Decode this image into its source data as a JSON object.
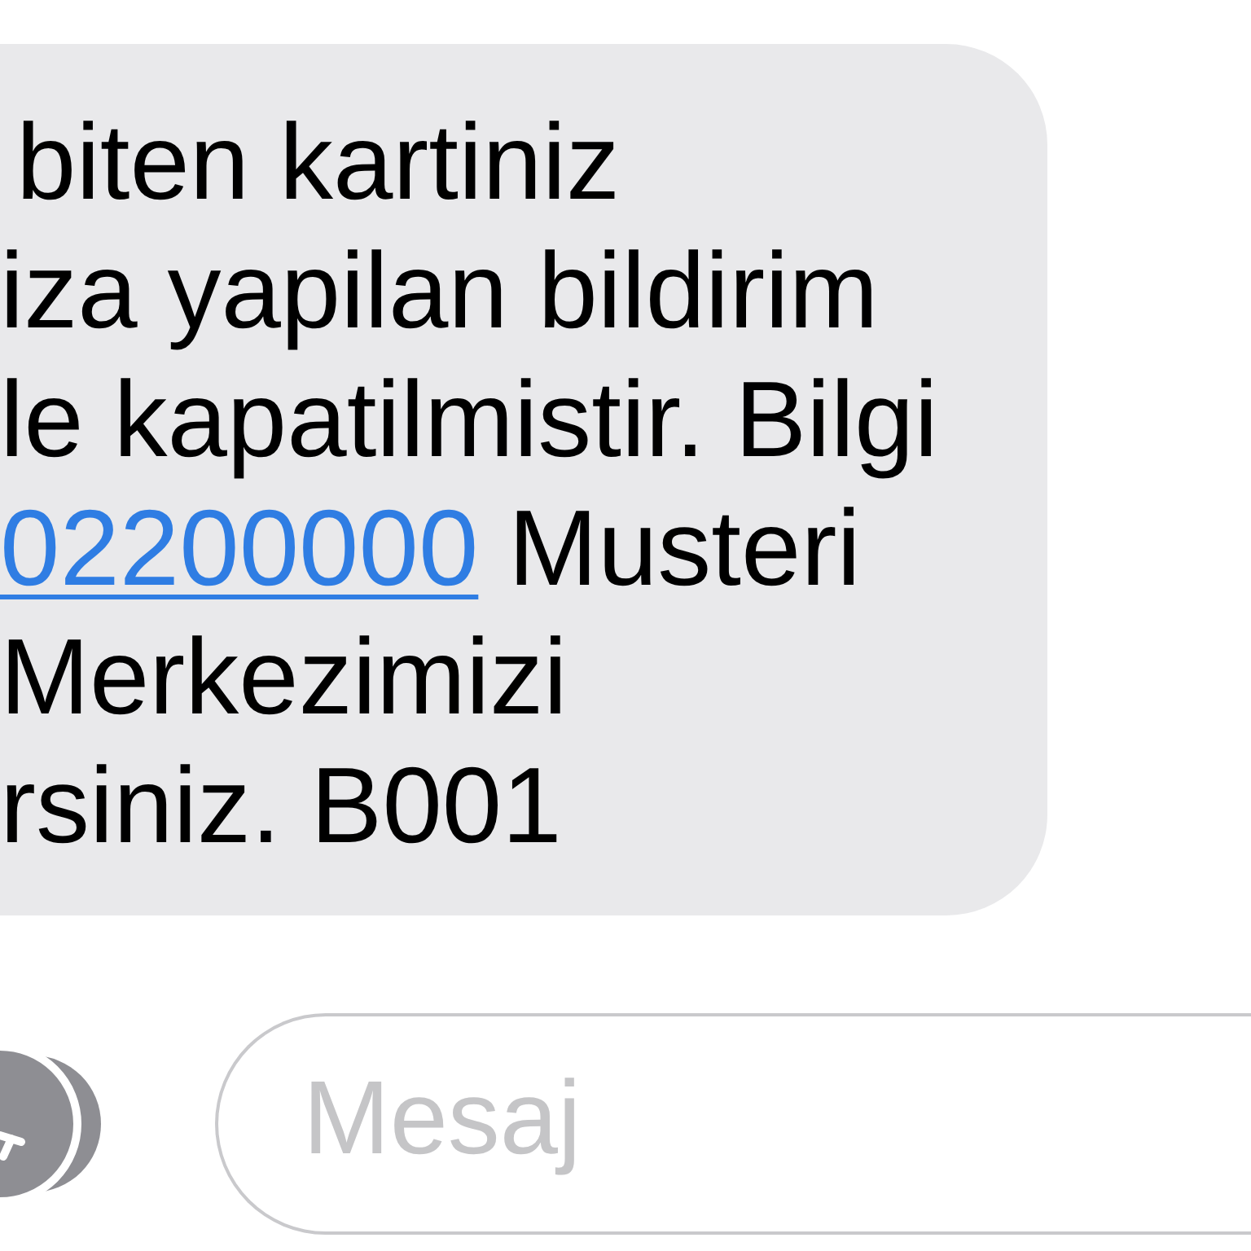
{
  "message": {
    "lines": [
      {
        "kind": "text",
        "text": "biten kartiniz"
      },
      {
        "kind": "text",
        "text": "iza yapilan bildirim"
      },
      {
        "kind": "text",
        "text": "le kapatilmistir. Bilgi"
      },
      {
        "kind": "link",
        "link": "02200000",
        "text": "Musteri"
      },
      {
        "kind": "text",
        "text": "Merkezimizi"
      },
      {
        "kind": "text",
        "text": "rsiniz. B001"
      }
    ]
  },
  "compose": {
    "placeholder": "Mesaj"
  }
}
